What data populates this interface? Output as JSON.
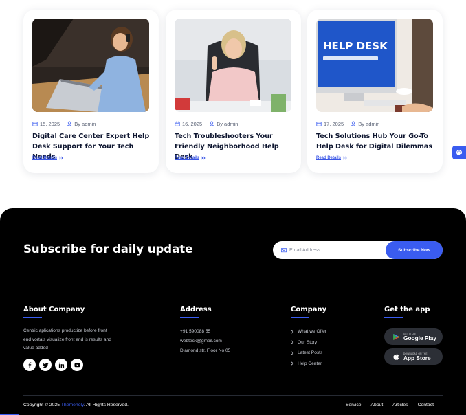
{
  "blog": {
    "cards": [
      {
        "date": "15, 2025",
        "author": "By admin",
        "title": "Digital Care Center Expert Help Desk Support for Your Tech Needs",
        "link": "Read Details",
        "image": "woman-on-phone-with-laptop-photo"
      },
      {
        "date": "16, 2025",
        "author": "By admin",
        "title": "Tech Troubleshooters Your Friendly Neighborhood Help Desk",
        "link": "Read Details",
        "image": "support-agent-with-headset-photo"
      },
      {
        "date": "17, 2025",
        "author": "By admin",
        "title": "Tech Solutions Hub Your Go-To Help Desk for Digital Dilemmas",
        "link": "Read Details",
        "image": "help-desk-monitor-photo",
        "screen_text": "HELP DESK"
      }
    ]
  },
  "subscribe": {
    "title": "Subscribe for daily update",
    "placeholder": "Email Address",
    "button": "Subscribe Now"
  },
  "footer": {
    "about": {
      "heading": "About Company",
      "text": "Centric aplications productize before front end vortals visualize front end is results and value added",
      "socials": [
        "facebook-icon",
        "twitter-icon",
        "linkedin-icon",
        "youtube-icon"
      ]
    },
    "address": {
      "heading": "Address",
      "phone": "+91 590088 55",
      "email": "webteck@gmail.com",
      "street": "Diamond str, Floor No 05"
    },
    "company": {
      "heading": "Company",
      "links": [
        "What we Offer",
        "Our Story",
        "Latest Posts",
        "Help Center"
      ]
    },
    "app": {
      "heading": "Get the app",
      "google": {
        "small": "GET IT ON",
        "big": "Google Play"
      },
      "apple": {
        "small": "DOWNLOAD ON THE",
        "big": "App Store"
      }
    },
    "copyright": {
      "prefix": "Copyright © 2025 ",
      "brand": "Themeholy",
      "suffix": ". All Rights Reserved."
    },
    "bottom_links": [
      "Service",
      "About",
      "Articles",
      "Contact"
    ]
  },
  "colors": {
    "accent": "#3a5cf0",
    "footer_bg": "#000000",
    "title_text": "#0e1630"
  }
}
